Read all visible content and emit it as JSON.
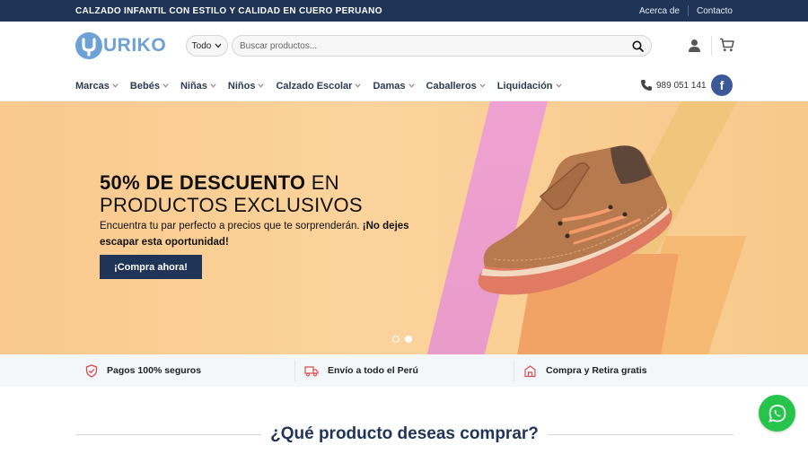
{
  "topbar": {
    "promo": "CALZADO INFANTIL CON ESTILO Y CALIDAD EN CUERO PERUANO",
    "links": [
      "Acerca de",
      "Contacto"
    ]
  },
  "header": {
    "logo_text": "URIKO",
    "search": {
      "category": "Todo",
      "placeholder": "Buscar productos..."
    },
    "icons": [
      "user-icon",
      "cart-icon"
    ]
  },
  "nav": {
    "items": [
      "Marcas",
      "Bebés",
      "Niñas",
      "Niños",
      "Calzado Escolar",
      "Damas",
      "Caballeros",
      "Liquidación"
    ],
    "phone": "989 051 141",
    "facebook": "f"
  },
  "hero": {
    "title_bold": "50% DE DESCUENTO",
    "title_rest_1": " EN",
    "title_line2": "PRODUCTOS EXCLUSIVOS",
    "subtitle": "Encuentra tu par perfecto a precios que te sorprenderán. ",
    "subtitle_bold": "¡No dejes escapar esta oportunidad!",
    "cta": "¡Compra ahora!",
    "slides": 2,
    "active_slide": 2
  },
  "features": [
    {
      "icon": "shield-check-icon",
      "label": "Pagos 100% seguros"
    },
    {
      "icon": "truck-icon",
      "label": "Envío a todo el Perú"
    },
    {
      "icon": "store-icon",
      "label": "Compra y Retira gratis"
    }
  ],
  "section": {
    "title": "¿Qué producto deseas comprar?"
  },
  "colors": {
    "navy": "#1f3457",
    "brand_blue": "#6ea1d6",
    "whatsapp": "#27c44b",
    "facebook": "#3b5998"
  }
}
